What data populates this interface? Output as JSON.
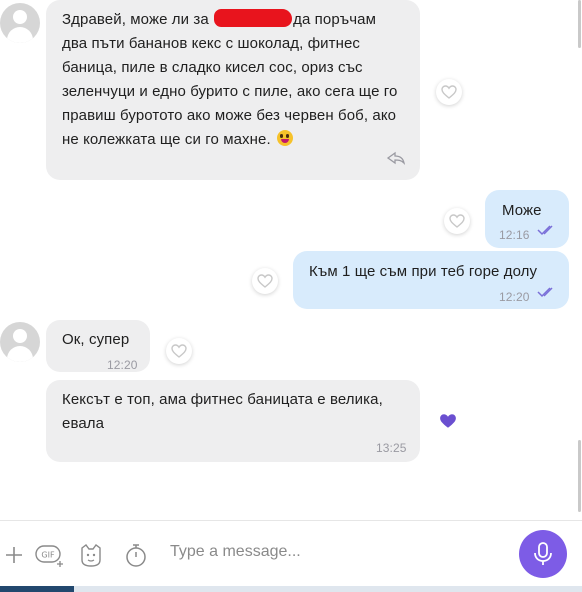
{
  "messages": [
    {
      "direction": "incoming",
      "text_before_redaction": "Здравей, може ли за",
      "text_after_redaction": "да поръчам два пъти бананов кекс с шоколад, фитнес баница, пиле в сладко кисел сос, ориз със зеленчуци и едно бурито с пиле, ако сега ще го правиш буротото ако може без червен боб, ако не колежката ще си го махне.",
      "emoji": "grinning-face-emoji",
      "status_icon": "reply-icon",
      "liked": false
    },
    {
      "direction": "outgoing",
      "text": "Може",
      "time": "12:16",
      "status": "read-double-check",
      "liked": false
    },
    {
      "direction": "outgoing",
      "text": "Към 1 ще съм при теб горе долу",
      "time": "12:20",
      "status": "read-double-check",
      "liked": false
    },
    {
      "direction": "incoming",
      "text": "Ок, супер",
      "time": "12:20",
      "liked": false
    },
    {
      "direction": "incoming",
      "text": "Кексът е топ, ама фитнес баницата е велика, евала",
      "time": "13:25",
      "liked": true
    }
  ],
  "composer": {
    "placeholder": "Type a message...",
    "icons": [
      "plus-icon",
      "gif-icon",
      "sticker-icon",
      "timer-icon",
      "microphone-icon"
    ]
  },
  "colors": {
    "incoming_bubble": "#eeeeef",
    "outgoing_bubble": "#d8ebfc",
    "accent": "#7d5ce6",
    "read_ticks": "#7a6fd8",
    "redaction": "#e8141d"
  }
}
